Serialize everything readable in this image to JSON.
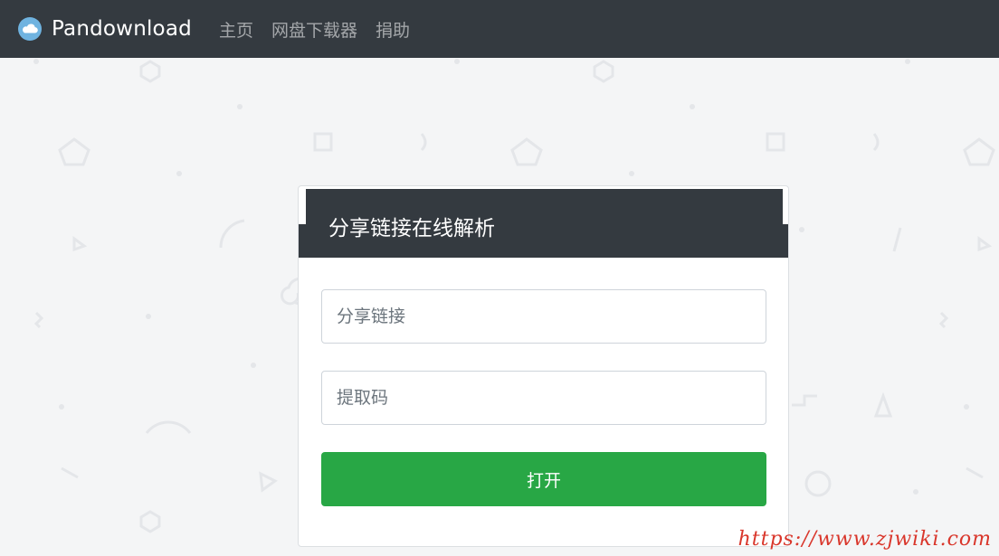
{
  "navbar": {
    "brand": "Pandownload",
    "links": [
      "主页",
      "网盘下载器",
      "捐助"
    ]
  },
  "card": {
    "title": "分享链接在线解析",
    "link_placeholder": "分享链接",
    "code_placeholder": "提取码",
    "open_label": "打开"
  },
  "watermark": "https://www.zjwiki.com",
  "icons": {
    "brand": "cloud-icon"
  },
  "colors": {
    "navbar": "#343a40",
    "primary_button": "#28a745",
    "page_bg": "#f4f5f6",
    "watermark": "#d9362b"
  }
}
